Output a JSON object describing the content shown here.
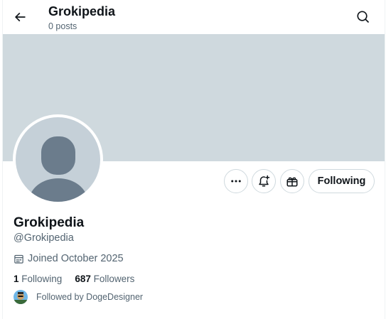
{
  "header": {
    "title": "Grokipedia",
    "subtitle": "0 posts",
    "back_icon": "arrow-left-icon",
    "search_icon": "search-icon"
  },
  "actions": {
    "more_icon": "more-icon",
    "notify_icon": "bell-plus-icon",
    "gift_icon": "gift-icon",
    "following_label": "Following"
  },
  "profile": {
    "name": "Grokipedia",
    "handle": "@Grokipedia",
    "joined": "Joined October 2025",
    "following_count": "1",
    "following_label": "Following",
    "followers_count": "687",
    "followers_label": "Followers",
    "followed_by": "Followed by DogeDesigner"
  },
  "colors": {
    "banner": "#cfd9de",
    "avatar_bg": "#c5d0d8",
    "avatar_silhouette": "#6b7c8c",
    "text_primary": "#0f1419",
    "text_secondary": "#536471",
    "border": "#cfd9de"
  }
}
